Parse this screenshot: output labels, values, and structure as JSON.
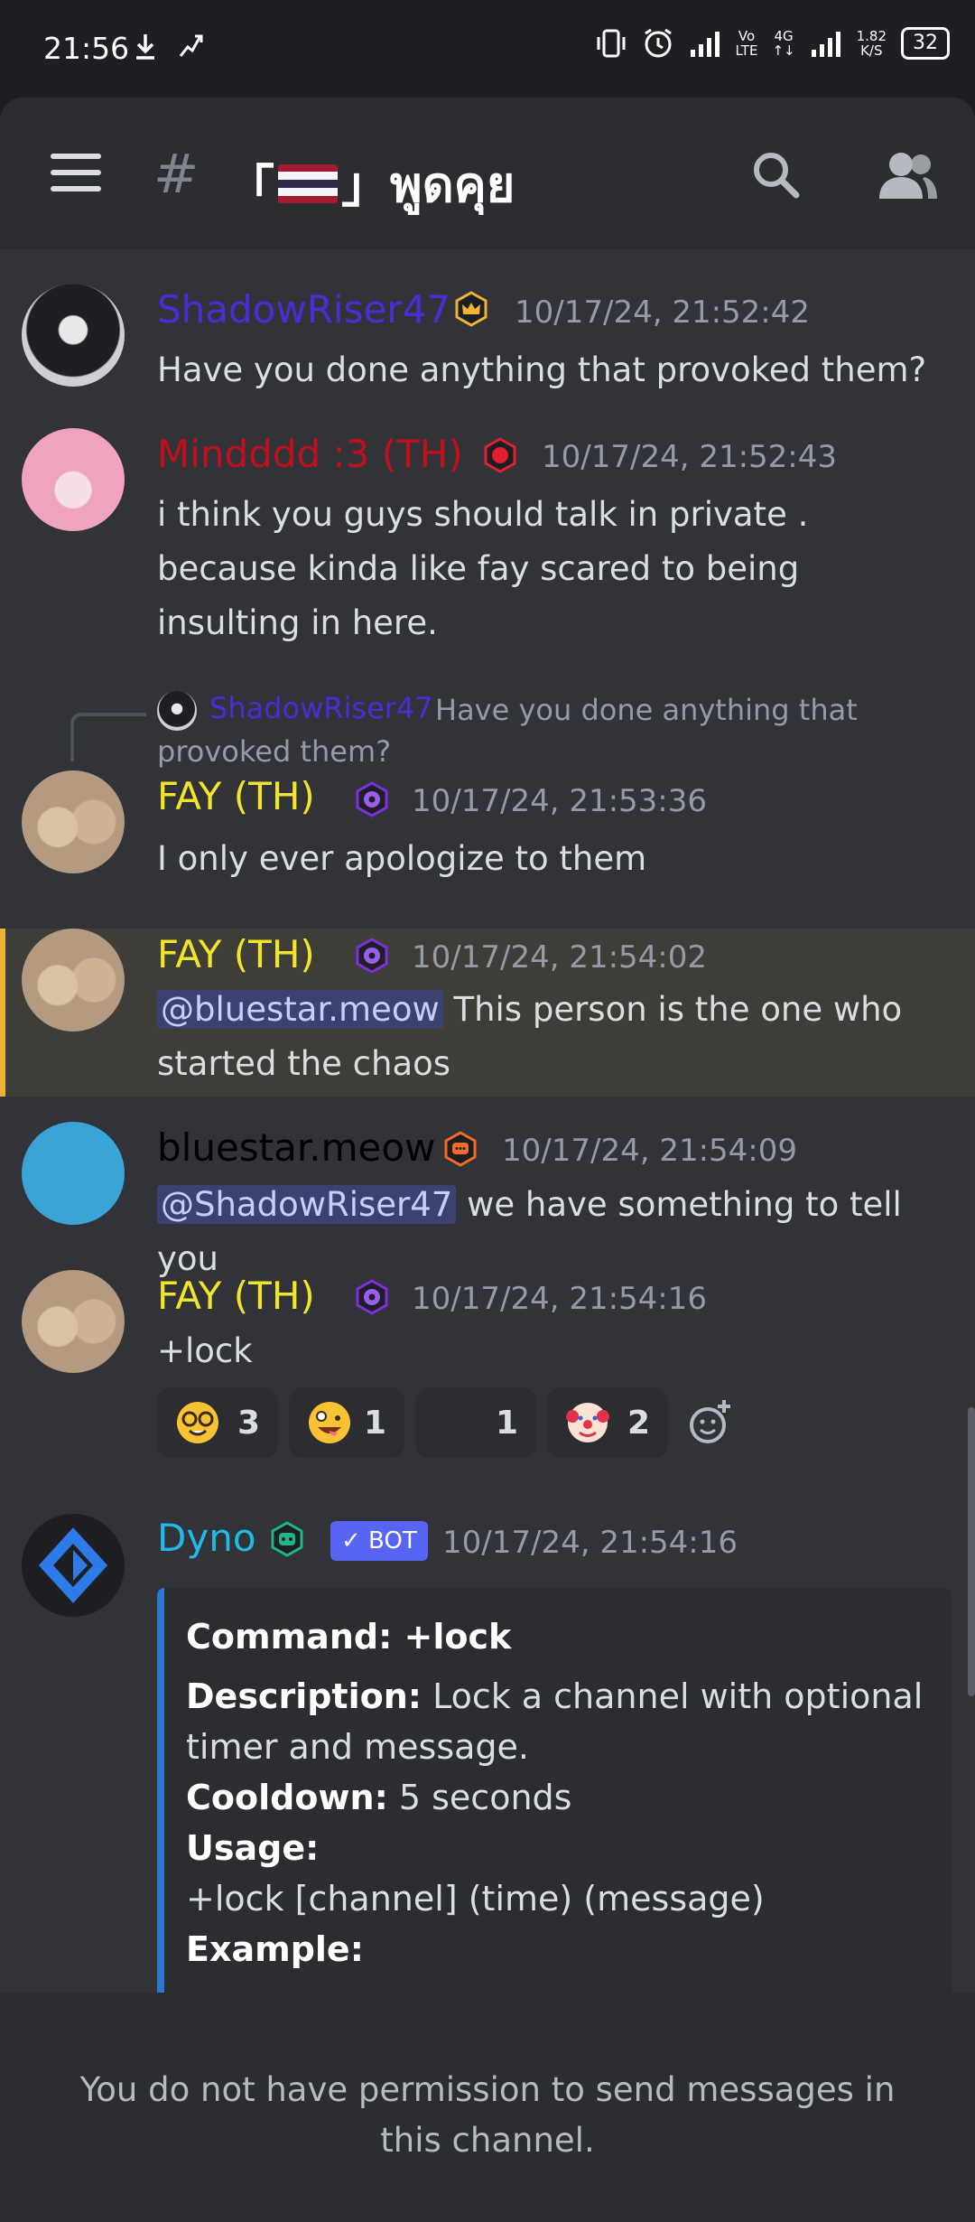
{
  "status_bar": {
    "time": "21:56",
    "network_speed": "1.82",
    "network_unit": "K/S",
    "battery": "32"
  },
  "header": {
    "channel_prefix": "#",
    "channel_name_left": "「",
    "channel_name_right": "」พูดคุย"
  },
  "messages": [
    {
      "author": "ShadowRiser47",
      "author_color": "#4a2bd6",
      "timestamp": "10/17/24, 21:52:42",
      "text": "Have you done anything that provoked them?"
    },
    {
      "author": "Mindddd :3 (TH)",
      "author_color": "#c00f1c",
      "timestamp": "10/17/24, 21:52:43",
      "text": "i think you guys should talk in private .\nbecause kinda like fay scared to being insulting in here."
    },
    {
      "reply_author": "ShadowRiser47",
      "reply_text_1": "Have you done anything that",
      "reply_text_2": "provoked them?",
      "author": "FAY (TH)",
      "author_color": "#f0e52a",
      "timestamp": "10/17/24, 21:53:36",
      "text": "I only ever apologize to them"
    },
    {
      "author": "FAY (TH)",
      "author_color": "#f0e52a",
      "timestamp": "10/17/24, 21:54:02",
      "mention": "@bluestar.meow",
      "text_line1": " This person is the one who",
      "text_line2": "started the chaos"
    },
    {
      "author": "bluestar.meow",
      "author_color": "#000000",
      "timestamp": "10/17/24, 21:54:09",
      "mention": "@ShadowRiser47",
      "text": " we have something to tell you"
    },
    {
      "author": "FAY (TH)",
      "author_color": "#f0e52a",
      "timestamp": "10/17/24, 21:54:16",
      "text": "+lock",
      "reactions": [
        {
          "emoji": "nerd-face",
          "count": "3"
        },
        {
          "emoji": "zany-face",
          "count": "1"
        },
        {
          "emoji": "blank",
          "count": "1"
        },
        {
          "emoji": "clown-face",
          "count": "2"
        }
      ]
    },
    {
      "author": "Dyno",
      "author_color": "#21b9e6",
      "badge": "✓ BOT",
      "timestamp": "10/17/24, 21:54:16",
      "embed": {
        "command_label": "Command:",
        "command_value": " +lock",
        "description_label": "Description:",
        "description_value": " Lock a channel with optional timer and message.",
        "cooldown_label": "Cooldown:",
        "cooldown_value": " 5 seconds",
        "usage_label": "Usage:",
        "usage_value": "+lock [channel] (time) (message)",
        "example_label": "Example:"
      }
    }
  ],
  "footer": {
    "no_permission": "You do not have permission to send messages in this channel."
  },
  "colors": {
    "background": "#313338",
    "header": "#2b2d31",
    "timestamp": "#949ba4",
    "highlight_border": "#f0b232",
    "embed_border": "#2879d4",
    "bot_badge": "#5865f2"
  }
}
